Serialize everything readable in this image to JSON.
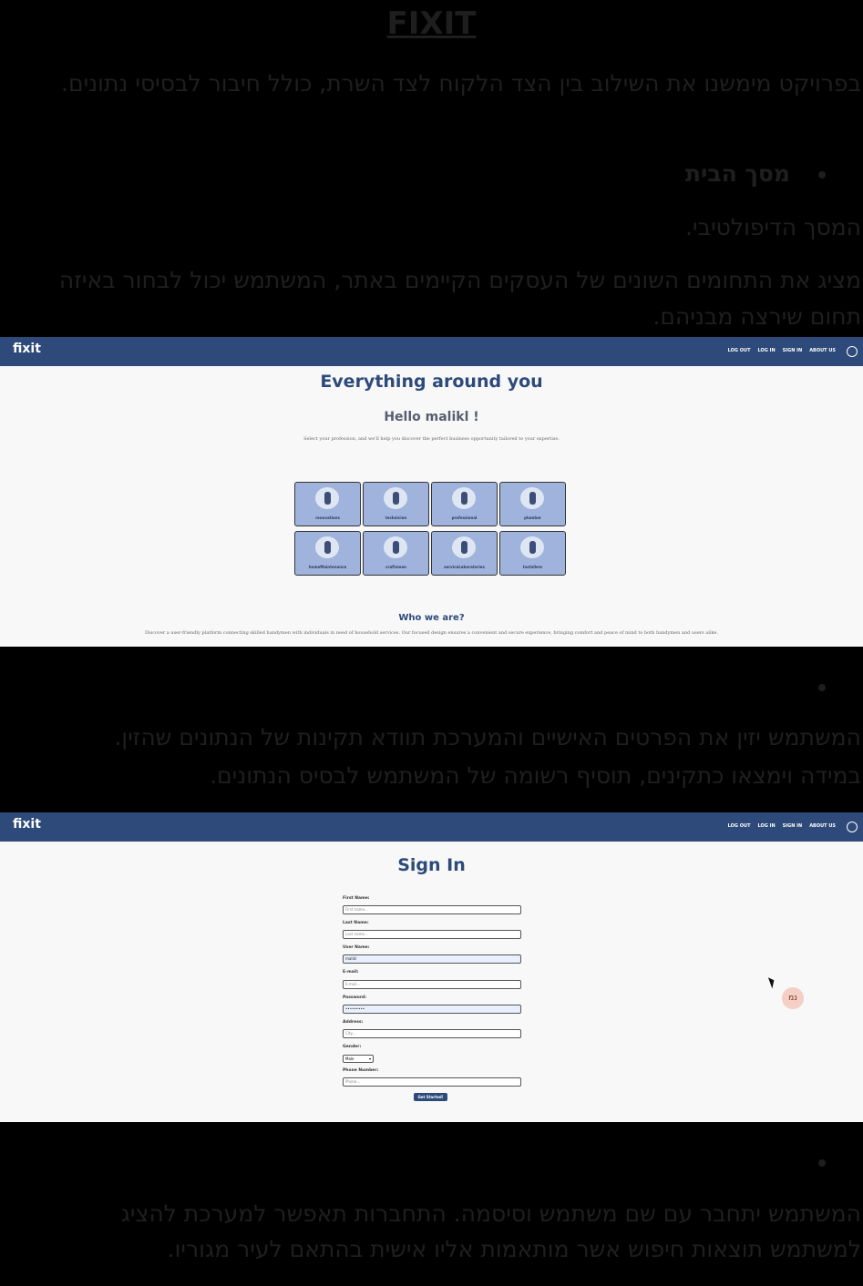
{
  "document": {
    "title": "FIXIT",
    "intro": "בפרויקט מימשנו את השילוב בין הצד הלקוח לצד השרת, כולל חיבור לבסיסי נתונים.",
    "section1_heading": "מסך הבית",
    "section1_line1": "המסך הדיפולטיבי.",
    "section1_line2a": "מציג את התחומים השונים של העסקים הקיימים באתר, המשתמש יכול לבחור באיזה",
    "section1_line2b": "תחום שירצה מבניהם.",
    "section2_line1": "המשתמש יזין את הפרטים האישיים והמערכת תוודא תקינות של הנתונים שהזין.",
    "section2_line2": "במידה וימצאו כתקינים, תוסיף רשומה של המשתמש לבסיס הנתונים.",
    "section3_line1": "המשתמש יתחבר עם שם משתמש וסיסמה. התחברות תאפשר למערכת להציג",
    "section3_line2": "למשתמש תוצאות חיפוש אשר מותאמות אליו אישית בהתאם לעיר מגוריו."
  },
  "nav": {
    "logo": "fixit",
    "links": [
      "LOG OUT",
      "LOG IN",
      "SIGN IN",
      "ABOUT US"
    ]
  },
  "home_screen": {
    "heading": "Everything around you",
    "greeting": "Hello malikl !",
    "subtitle": "Select your profession, and we'll help you discover the perfect business opportunity tailored to your expertise.",
    "categories": [
      "renovations",
      "technician",
      "professional",
      "plumber",
      "homeMaintenance",
      "craftsmen",
      "serviceLaboratories",
      "Installers"
    ],
    "who_heading": "Who we are?",
    "who_text": "Discover a user-friendly platform connecting skilled handymen with individuals in need of household services. Our focused design ensures a convenient and secure experience, bringing comfort and peace of mind to both handymen and users alike."
  },
  "signin_screen": {
    "heading": "Sign In",
    "first_name_label": "First Name:",
    "first_name_placeholder": "First name...",
    "last_name_label": "Last Name:",
    "last_name_placeholder": "Last name...",
    "user_name_label": "User Name:",
    "user_name_value": "malikl",
    "email_label": "E-mail:",
    "email_placeholder": "E-mail...",
    "password_label": "Password:",
    "password_value": "•••••••••",
    "address_label": "Address:",
    "address_placeholder": "City...",
    "gender_label": "Gender:",
    "gender_value": "Male",
    "phone_label": "Phone Number:",
    "phone_placeholder": "Phone...",
    "submit_label": "Get Started!",
    "presence_initials": "נמ"
  }
}
